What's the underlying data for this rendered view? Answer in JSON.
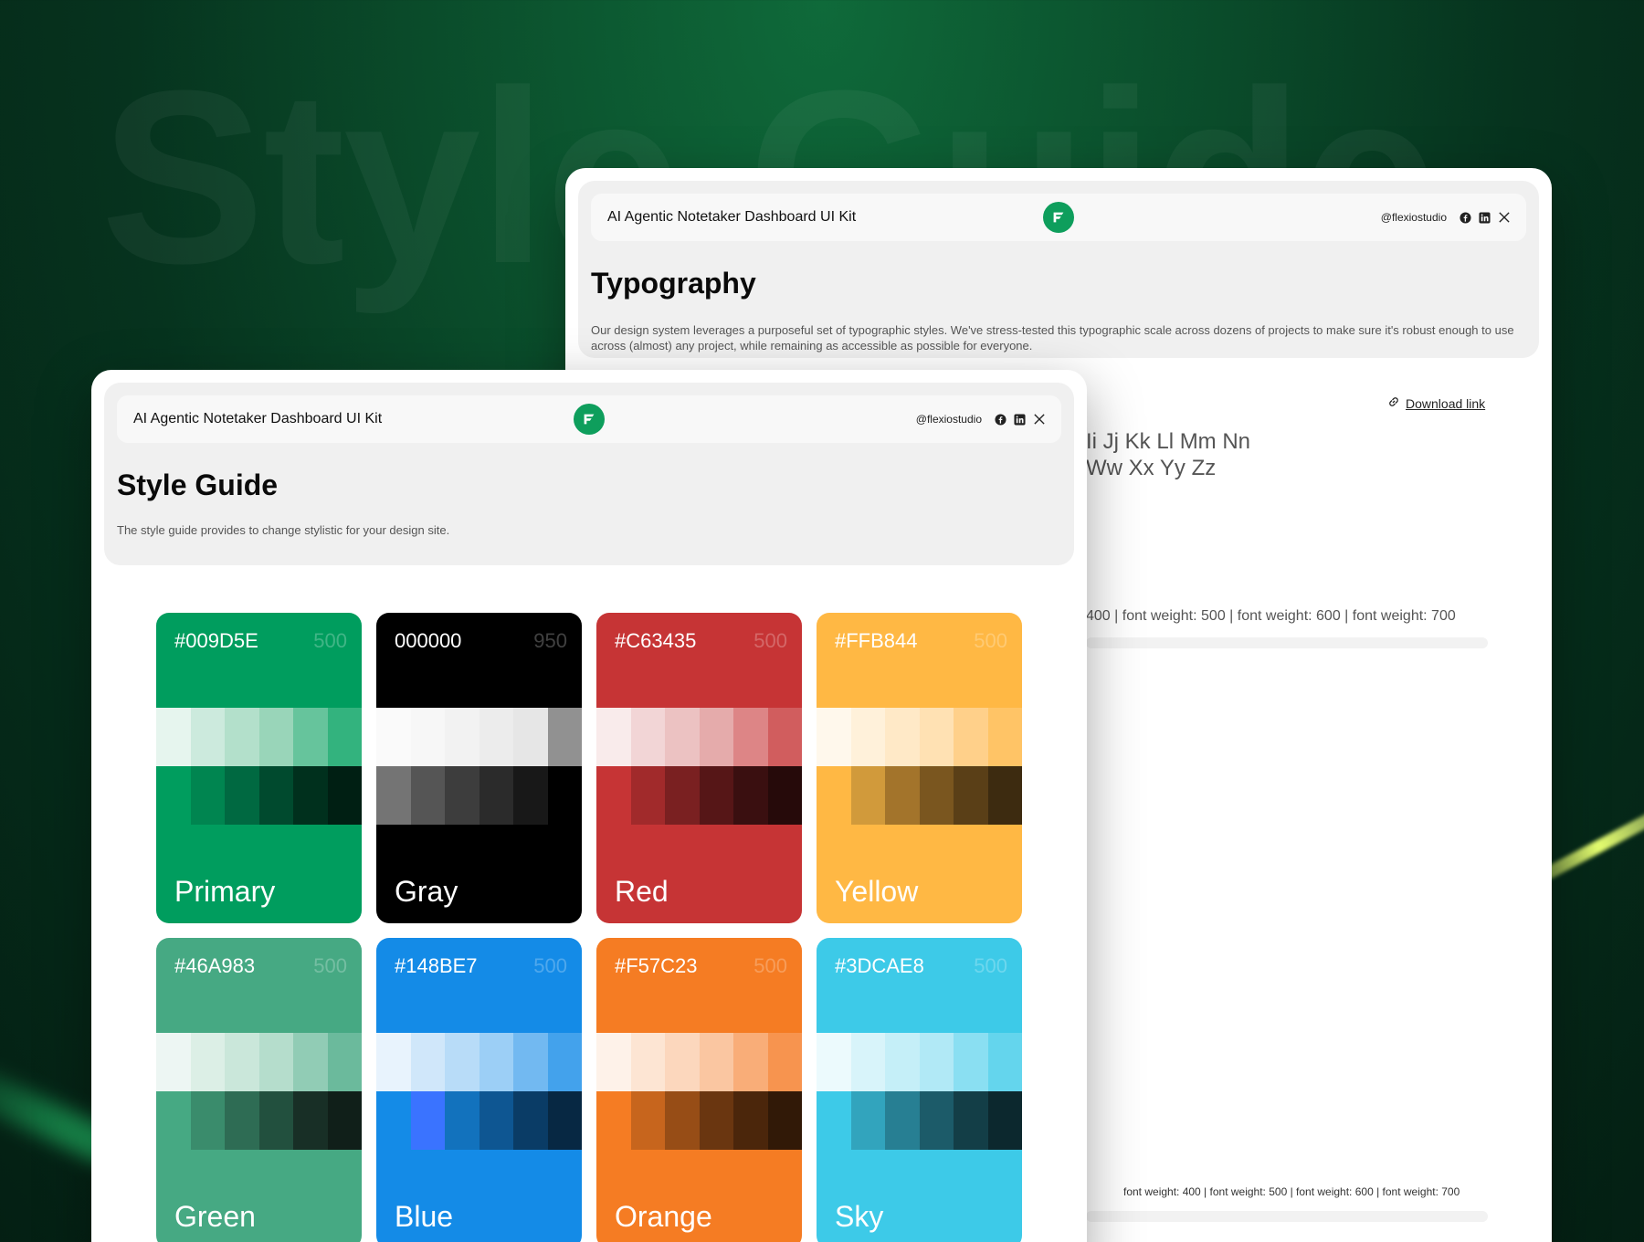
{
  "background": {
    "watermark": "Style Guide"
  },
  "typography_window": {
    "kit_title": "AI Agentic Notetaker Dashboard UI Kit",
    "handle": "@flexiostudio",
    "title": "Typography",
    "description": "Our design system leverages a purposeful set of typographic styles. We've stress-tested this typographic scale across dozens of projects to make sure it's robust enough to use across (almost) any project, while remaining as accessible as possible for everyone.",
    "download_label": "Download link",
    "alphabet_line1": "Ii Jj Kk Ll Mm Nn",
    "alphabet_line2": "Ww Xx Yy Zz",
    "weights_large": "400  |  font weight: 500  |  font weight: 600  |  font weight: 700",
    "weights_small": "font weight: 400  |  font weight: 500  |  font weight: 600  |  font weight: 700"
  },
  "style_window": {
    "kit_title": "AI Agentic Notetaker Dashboard UI Kit",
    "handle": "@flexiostudio",
    "title": "Style Guide",
    "description": "The style guide provides to change stylistic for your design site."
  },
  "palettes": [
    {
      "hex": "#009D5E",
      "shade": "500",
      "name": "Primary",
      "base": "#009D5E",
      "light": [
        "#e6f5ee",
        "#cceadd",
        "#b3e0cb",
        "#99d5b9",
        "#66c49c",
        "#33b37e"
      ],
      "dark": [
        "#009D5E",
        "#008550",
        "#006941",
        "#004a2e",
        "#00301d",
        "#001f13"
      ]
    },
    {
      "hex": "000000",
      "shade": "950",
      "name": "Gray",
      "base": "#000000",
      "light": [
        "#fafafa",
        "#f7f7f7",
        "#f2f2f2",
        "#ececec",
        "#e6e6e6",
        "#919191"
      ],
      "dark": [
        "#747474",
        "#555555",
        "#3d3d3d",
        "#2b2b2b",
        "#181818",
        "#000000"
      ]
    },
    {
      "hex": "#C63435",
      "shade": "500",
      "name": "Red",
      "base": "#C63435",
      "light": [
        "#f9ebeb",
        "#f2d5d6",
        "#ecc2c2",
        "#e5abab",
        "#dd8586",
        "#d15d5e"
      ],
      "dark": [
        "#C63435",
        "#a12a2b",
        "#7a2021",
        "#561617",
        "#3a0f10",
        "#260a0a"
      ]
    },
    {
      "hex": "#FFB844",
      "shade": "500",
      "name": "Yellow",
      "base": "#FFB844",
      "light": [
        "#fff8ec",
        "#fff1da",
        "#ffe9c7",
        "#ffe1b3",
        "#ffd08a",
        "#ffc466"
      ],
      "dark": [
        "#FFB844",
        "#d19a3b",
        "#a3742b",
        "#7a561f",
        "#5a3f17",
        "#3d2b10"
      ]
    },
    {
      "hex": "#46A983",
      "shade": "500",
      "name": "Green",
      "base": "#46A983",
      "light": [
        "#edf6f3",
        "#dcefe6",
        "#cae7da",
        "#b5ddcc",
        "#91ccb5",
        "#6bba9c"
      ],
      "dark": [
        "#46A983",
        "#3a8c6c",
        "#2e6c54",
        "#22503e",
        "#182f26",
        "#101f19"
      ]
    },
    {
      "hex": "#148BE7",
      "shade": "500",
      "name": "Blue",
      "base": "#148BE7",
      "light": [
        "#e8f3fd",
        "#d0e7fa",
        "#b8dcf8",
        "#9ccff6",
        "#72b9f1",
        "#43a2ec"
      ],
      "dark": [
        "#148BE7",
        "#3a73ff",
        "#1272bd",
        "#0e5692",
        "#0a3c66",
        "#072843"
      ]
    },
    {
      "hex": "#F57C23",
      "shade": "500",
      "name": "Orange",
      "base": "#F57C23",
      "light": [
        "#fef2e9",
        "#fde5d3",
        "#fcd7bd",
        "#fac6a1",
        "#f9ad78",
        "#f7944f"
      ],
      "dark": [
        "#F57C23",
        "#c7651d",
        "#974d16",
        "#6a3610",
        "#4b260b",
        "#311907"
      ]
    },
    {
      "hex": "#3DCAE8",
      "shade": "500",
      "name": "Sky",
      "base": "#3DCAE8",
      "light": [
        "#ecfafd",
        "#d8f4fa",
        "#c5eff8",
        "#b1e9f6",
        "#8adff2",
        "#64d5ed"
      ],
      "dark": [
        "#3DCAE8",
        "#32a4bd",
        "#277f93",
        "#1c5b69",
        "#133e47",
        "#0c282e"
      ]
    }
  ]
}
